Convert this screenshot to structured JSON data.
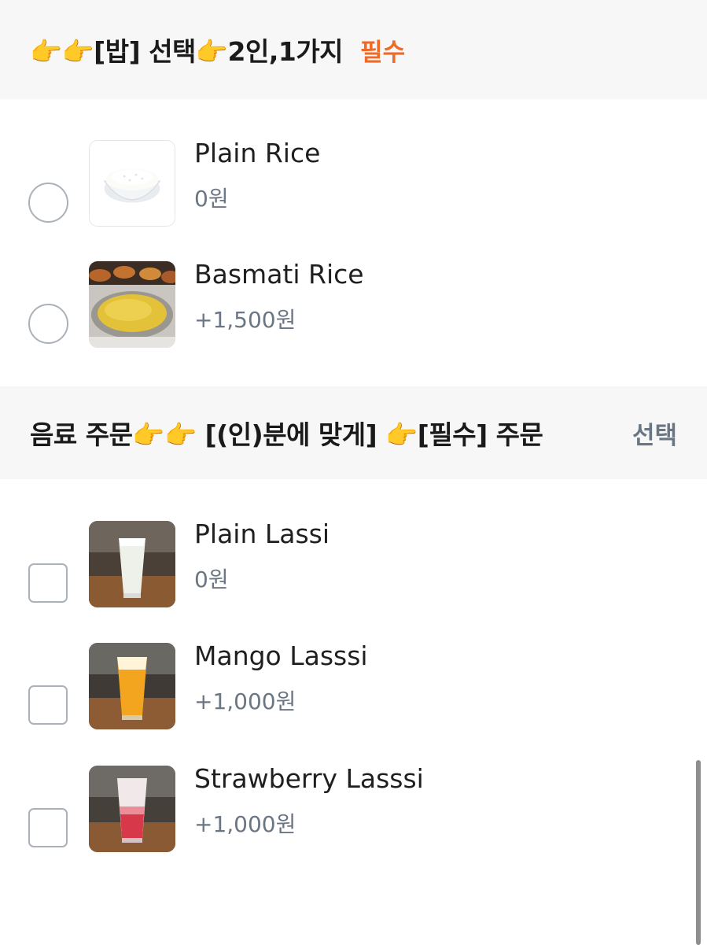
{
  "sections": {
    "rice": {
      "title": "👉👉[밥] 선택👉2인,1가지",
      "tag": "필수",
      "options": [
        {
          "name": "Plain Rice",
          "price": "0원",
          "control": "radio",
          "image": "plain-rice-bowl"
        },
        {
          "name": "Basmati Rice",
          "price": "+1,500원",
          "control": "radio",
          "image": "basmati-rice-plate"
        }
      ]
    },
    "drink": {
      "title": "음료 주문👉👉 [(인)분에 맞게] 👉[필수] 주문",
      "tag": "선택",
      "options": [
        {
          "name": "Plain Lassi",
          "price": "0원",
          "control": "checkbox",
          "image": "plain-lassi-glass"
        },
        {
          "name": "Mango Lasssi",
          "price": "+1,000원",
          "control": "checkbox",
          "image": "mango-lassi-glass"
        },
        {
          "name": "Strawberry Lasssi",
          "price": "+1,000원",
          "control": "checkbox",
          "image": "strawberry-lassi-glass"
        }
      ]
    }
  },
  "colors": {
    "required_tag": "#ef6a25",
    "optional_tag": "#6b7684",
    "header_bg": "#f7f7f8",
    "control_border": "#aab1b9"
  }
}
